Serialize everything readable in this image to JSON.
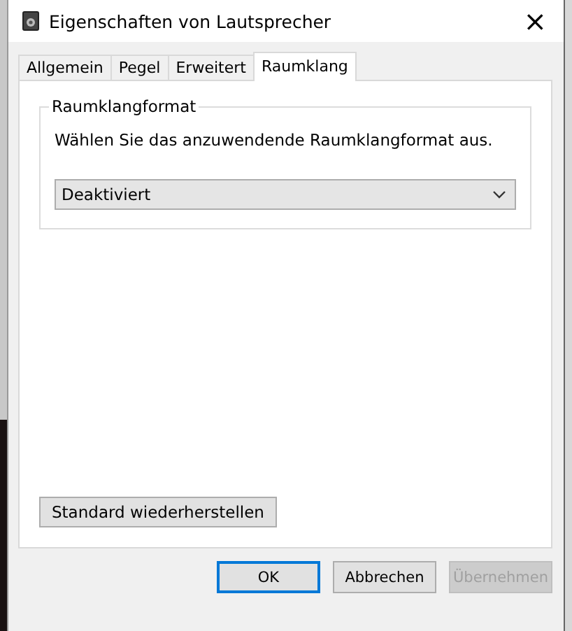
{
  "window": {
    "title": "Eigenschaften von Lautsprecher",
    "close": "×"
  },
  "tabs": [
    {
      "label": "Allgemein",
      "selected": false
    },
    {
      "label": "Pegel",
      "selected": false
    },
    {
      "label": "Erweitert",
      "selected": false
    },
    {
      "label": "Raumklang",
      "selected": true
    }
  ],
  "group": {
    "title": "Raumklangformat",
    "description": "Wählen Sie das anzuwendende Raumklangformat aus.",
    "dropdown": {
      "value": "Deaktiviert"
    }
  },
  "restore_button": "Standard wiederherstellen",
  "buttons": [
    {
      "label": "OK",
      "default": true,
      "disabled": false
    },
    {
      "label": "Abbrechen",
      "default": false,
      "disabled": false
    },
    {
      "label": "Übernehmen",
      "default": false,
      "disabled": true
    }
  ]
}
